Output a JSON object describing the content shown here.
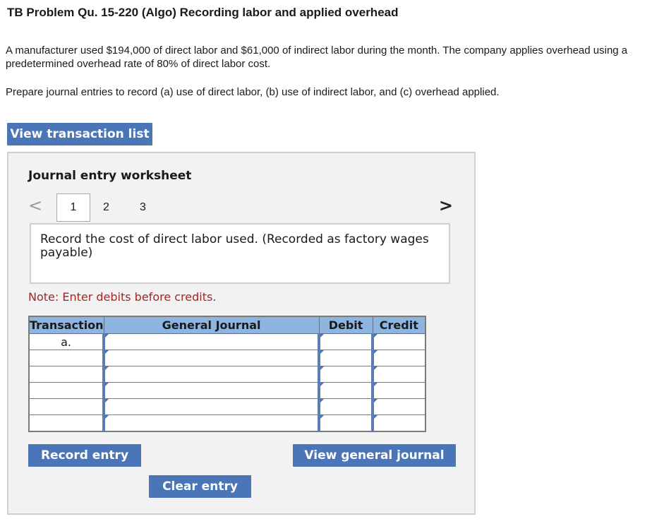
{
  "problem": {
    "title": "TB Problem Qu. 15-220 (Algo) Recording labor and applied overhead",
    "paragraph1": "A manufacturer used $194,000 of direct labor and $61,000 of indirect labor during the month. The company applies overhead using a predetermined overhead rate of 80% of direct labor cost.",
    "paragraph2": "Prepare journal entries to record (a) use of direct labor, (b) use of indirect labor, and (c) overhead applied."
  },
  "buttons": {
    "view_transactions": "View transaction list",
    "record_entry": "Record entry",
    "view_journal": "View general journal",
    "clear_entry": "Clear entry"
  },
  "worksheet": {
    "title": "Journal entry worksheet",
    "nav_prev": "<",
    "nav_next": ">",
    "pages": [
      "1",
      "2",
      "3"
    ],
    "current_page": "1",
    "instruction": "Record the cost of direct labor used. (Recorded as factory wages payable)",
    "note": "Note: Enter debits before credits."
  },
  "journal_table": {
    "headers": [
      "Transaction",
      "General Journal",
      "Debit",
      "Credit"
    ],
    "rows": [
      {
        "transaction": "a.",
        "account": "",
        "debit": "",
        "credit": ""
      },
      {
        "transaction": "",
        "account": "",
        "debit": "",
        "credit": ""
      },
      {
        "transaction": "",
        "account": "",
        "debit": "",
        "credit": ""
      },
      {
        "transaction": "",
        "account": "",
        "debit": "",
        "credit": ""
      },
      {
        "transaction": "",
        "account": "",
        "debit": "",
        "credit": ""
      },
      {
        "transaction": "",
        "account": "",
        "debit": "",
        "credit": ""
      }
    ]
  },
  "colors": {
    "button_blue": "#4a76b8",
    "table_header": "#8eb4e0",
    "note_red": "#a02727",
    "worksheet_bg": "#f2f2f2"
  }
}
